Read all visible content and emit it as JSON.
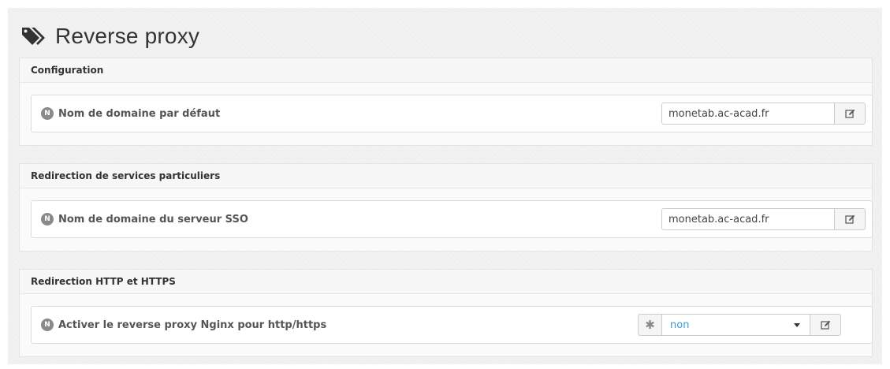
{
  "page": {
    "title": "Reverse proxy"
  },
  "sections": [
    {
      "header": "Configuration",
      "field": {
        "badge": "N",
        "label": "Nom de domaine par défaut",
        "value": "monetab.ac-acad.fr"
      }
    },
    {
      "header": "Redirection de services particuliers",
      "field": {
        "badge": "N",
        "label": "Nom de domaine du serveur SSO",
        "value": "monetab.ac-acad.fr"
      }
    },
    {
      "header": "Redirection HTTP et HTTPS",
      "field": {
        "badge": "N",
        "label": "Activer le reverse proxy Nginx pour http/https",
        "required_mark": "✱",
        "selected": "non"
      }
    }
  ],
  "icons": {
    "title_icon": "tags-icon",
    "edit_icon": "edit-icon",
    "dropdown_icon": "chevron-down-icon"
  },
  "colors": {
    "background": "#f2f2f2",
    "select_text": "#3a9ad9",
    "badge": "#8a8a8a"
  }
}
